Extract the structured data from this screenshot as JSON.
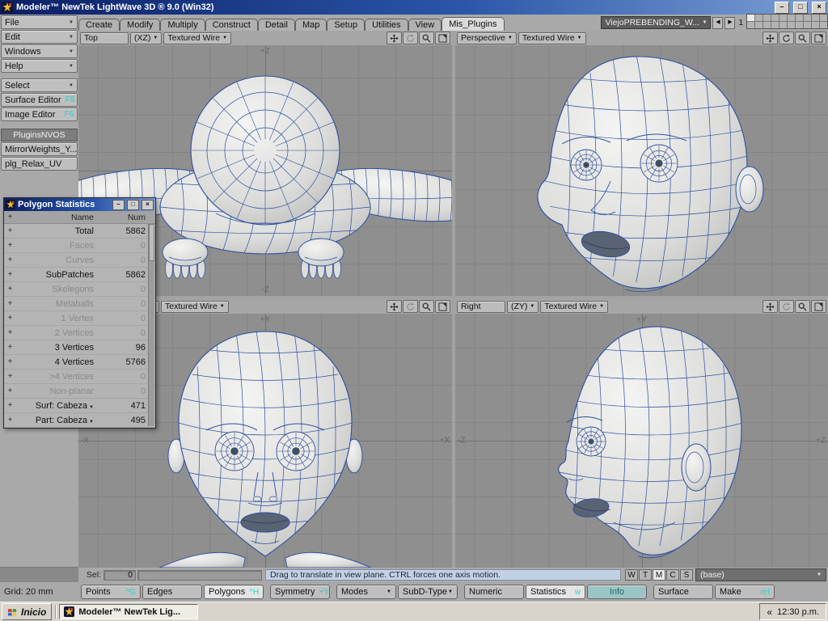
{
  "icons": {
    "minimize": "–",
    "maximize": "□",
    "close": "×",
    "dropdown_arrow": "▼",
    "left_arrow": "◀",
    "right_arrow": "▶",
    "tray_chevron": "«",
    "plus": "+"
  },
  "colors": {
    "wireframe": "#2b4fa0",
    "accent_cyan": "#2fd0c4",
    "hint_bg": "#c3d2e3"
  },
  "titlebar": {
    "title": "Modeler™ NewTek LightWave 3D ® 9.0 (Win32)"
  },
  "sidebar": {
    "menus": [
      "File",
      "Edit",
      "Windows",
      "Help"
    ],
    "select_label": "Select",
    "editor_buttons": [
      {
        "label": "Surface Editor",
        "shortcut": "F5"
      },
      {
        "label": "Image Editor",
        "shortcut": "F6"
      }
    ],
    "plugins_header": "PluginsNVOS",
    "plugin_buttons": [
      "MirrorWeights_Y...",
      "plg_Relax_UV"
    ]
  },
  "tabbar": {
    "tabs": [
      "Create",
      "Modify",
      "Multiply",
      "Construct",
      "Detail",
      "Map",
      "Setup",
      "Utilities",
      "View",
      "Mis_Plugins"
    ],
    "active_tab": "Mis_Plugins",
    "preset_dropdown": "ViejoPREBENDING_W...",
    "layer_number": "1"
  },
  "viewports": {
    "top_left": {
      "view_name": "Top",
      "axis_mode": "(XZ)",
      "render_mode": "Textured Wire",
      "axis_labels": {
        "top": "+Z",
        "bottom": "-Z"
      }
    },
    "top_right": {
      "view_name": "Perspective",
      "render_mode": "Textured Wire"
    },
    "bottom_left": {
      "render_mode": "Textured Wire",
      "axis_labels": {
        "top": "+Y",
        "left": "-X",
        "right": "+X"
      }
    },
    "bottom_right": {
      "view_name": "Right",
      "axis_mode": "(ZY)",
      "render_mode": "Textured Wire",
      "axis_labels": {
        "top": "+Y",
        "left": "-Z",
        "right": "+Z"
      }
    }
  },
  "stats_panel": {
    "title": "Polygon Statistics",
    "col_name": "Name",
    "col_num": "Num",
    "rows": [
      {
        "name": "Total",
        "num": "5862"
      },
      {
        "name": "Faces",
        "num": "0"
      },
      {
        "name": "Curves",
        "num": "0"
      },
      {
        "name": "SubPatches",
        "num": "5862"
      },
      {
        "name": "Skelegons",
        "num": "0"
      },
      {
        "name": "Metaballs",
        "num": "0"
      },
      {
        "name": "1 Vertex",
        "num": "0"
      },
      {
        "name": "2 Vertices",
        "num": "0"
      },
      {
        "name": "3 Vertices",
        "num": "96"
      },
      {
        "name": "4 Vertices",
        "num": "5766"
      },
      {
        "name": ">4 Vertices",
        "num": "0"
      },
      {
        "name": "Non-planar",
        "num": "0"
      },
      {
        "name": "Surf: Cabeza",
        "num": "471"
      },
      {
        "name": "Part: Cabeza",
        "num": "495"
      }
    ]
  },
  "status_row": {
    "sel_label": "Sel:",
    "sel_value": "0",
    "hint": "Drag to translate in view plane. CTRL forces one axis motion.",
    "vmap_buttons": [
      "W",
      "T",
      "M",
      "C",
      "S"
    ],
    "active_vmap": "M",
    "vmap_selection": "(base)"
  },
  "toolbar": {
    "grid_label": "Grid:",
    "grid_value": "20 mm",
    "points": {
      "label": "Points",
      "shortcut": "^G"
    },
    "edges": {
      "label": "Edges"
    },
    "polygons": {
      "label": "Polygons",
      "shortcut": "^H"
    },
    "symmetry": {
      "label": "Symmetry",
      "shortcut": "+Y"
    },
    "modes": "Modes",
    "subd_type": "SubD-Type",
    "numeric": {
      "label": "Numeric"
    },
    "statistics": {
      "label": "Statistics",
      "shortcut": "w"
    },
    "info": {
      "label": "Info"
    },
    "surface": {
      "label": "Surface"
    },
    "make": {
      "label": "Make",
      "shortcut": "ret"
    }
  },
  "taskbar": {
    "start_button": "Inicio",
    "task_button": "Modeler™ NewTek Lig...",
    "clock": "12:30 p.m."
  }
}
